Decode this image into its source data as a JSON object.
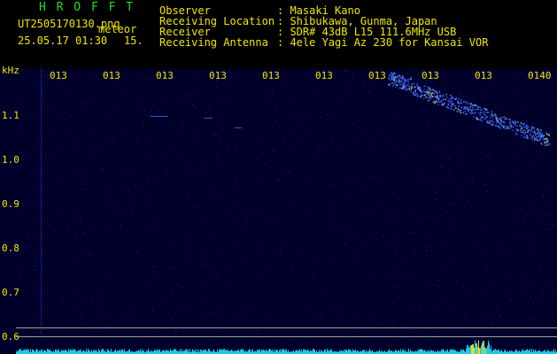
{
  "app": {
    "title": "H R O F F T",
    "filename": "UT2505170130.png",
    "category": "meteor",
    "date_time": "25.05.17 01:30",
    "interval": "15."
  },
  "info": [
    {
      "label": "Observer",
      "value": ": Masaki Kano"
    },
    {
      "label": "Receiving Location",
      "value": ": Shibukawa, Gunma, Japan"
    },
    {
      "label": "Receiver",
      "value": ": SDR# 43dB L15 111.6MHz USB"
    },
    {
      "label": "Receiving Antenna",
      "value": ": 4ele Yagi Az 230 for Kansai VOR"
    }
  ],
  "axes": {
    "unit": "kHz",
    "y_ticks": [
      "1.1",
      "1.0",
      "0.9",
      "0.8",
      "0.7",
      "0.6"
    ],
    "x_ticks": [
      "013",
      "013",
      "013",
      "013",
      "013",
      "013",
      "013",
      "013",
      "013",
      "0140"
    ]
  },
  "colors": {
    "background": "#00002a",
    "text": "#f2e600",
    "title": "#22dd22",
    "echo": "#3b6cff"
  }
}
